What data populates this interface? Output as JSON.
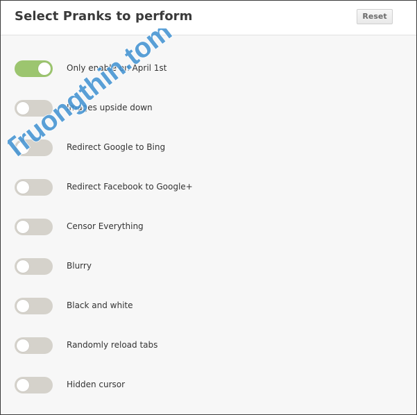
{
  "header": {
    "title": "Select Pranks to perform",
    "reset_label": "Reset"
  },
  "colors": {
    "toggle_on": "#9cc56f",
    "toggle_off": "#d5d2cb"
  },
  "options": [
    {
      "label": "Only enable on April 1st",
      "enabled": true
    },
    {
      "label": "Images upside down",
      "enabled": false
    },
    {
      "label": "Redirect Google to Bing",
      "enabled": false
    },
    {
      "label": "Redirect Facebook to Google+",
      "enabled": false
    },
    {
      "label": "Censor Everything",
      "enabled": false
    },
    {
      "label": "Blurry",
      "enabled": false
    },
    {
      "label": "Black and white",
      "enabled": false
    },
    {
      "label": "Randomly reload tabs",
      "enabled": false
    },
    {
      "label": "Hidden cursor",
      "enabled": false
    }
  ],
  "watermark": {
    "text": "Truongthin.tom"
  }
}
